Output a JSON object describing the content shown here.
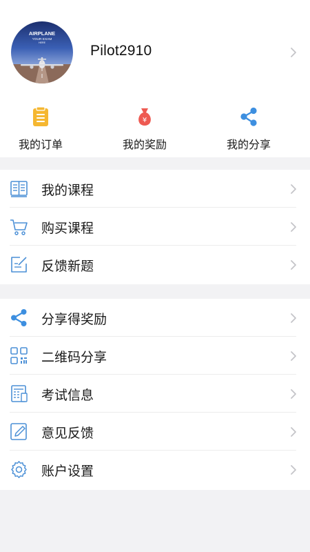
{
  "profile": {
    "username": "Pilot2910",
    "avatar_text": {
      "line1": "AIRPLANE",
      "line2": "YOUR EXAM",
      "line3": "HERE"
    }
  },
  "quick_actions": [
    {
      "label": "我的订单",
      "icon": "clipboard-icon",
      "color": "#f5b731"
    },
    {
      "label": "我的奖励",
      "icon": "money-bag-icon",
      "color": "#ee5a52"
    },
    {
      "label": "我的分享",
      "icon": "share-icon",
      "color": "#3d8fe0"
    }
  ],
  "menu_group_1": [
    {
      "label": "我的课程",
      "icon": "book-icon"
    },
    {
      "label": "购买课程",
      "icon": "cart-icon"
    },
    {
      "label": "反馈新题",
      "icon": "edit-box-icon"
    }
  ],
  "menu_group_2": [
    {
      "label": "分享得奖励",
      "icon": "share-icon"
    },
    {
      "label": "二维码分享",
      "icon": "qrcode-icon"
    },
    {
      "label": "考试信息",
      "icon": "exam-info-icon"
    },
    {
      "label": "意见反馈",
      "icon": "feedback-pen-icon"
    },
    {
      "label": "账户设置",
      "icon": "settings-gear-icon"
    }
  ],
  "colors": {
    "accent_blue": "#3d8fe0",
    "icon_line": "#4a8fd6",
    "background": "#f2f2f4",
    "chevron": "#c4c4c8"
  }
}
